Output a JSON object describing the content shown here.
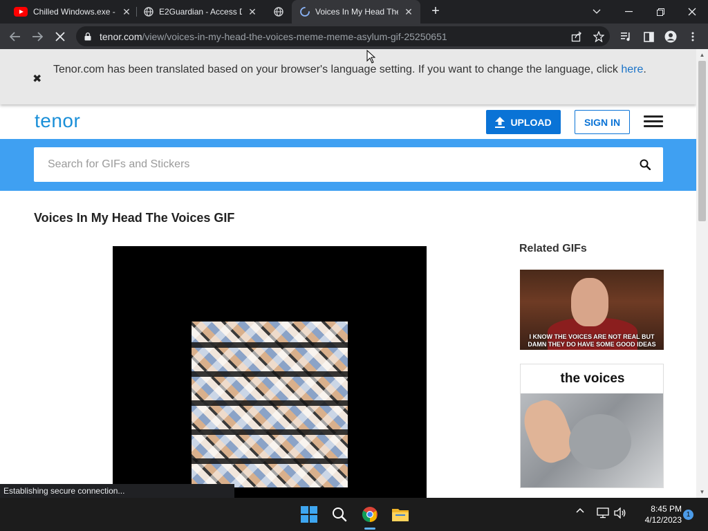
{
  "browser": {
    "tabs": [
      {
        "title": "Chilled Windows.exe -",
        "icon": "youtube-icon",
        "active": false
      },
      {
        "title": "E2Guardian - Access De",
        "icon": "globe-icon",
        "active": false
      },
      {
        "title": "",
        "icon": "globe-icon",
        "active": false
      },
      {
        "title": "Voices In My Head The",
        "icon": "loading-spinner-icon",
        "active": true
      }
    ],
    "url_host": "tenor.com",
    "url_path": "/view/voices-in-my-head-the-voices-meme-meme-asylum-gif-25250651",
    "status_text": "Establishing secure connection..."
  },
  "translate_bar": {
    "message": "Tenor.com has been translated based on your browser's language setting. If you want to change the language, click ",
    "link_text": "here",
    "suffix": "."
  },
  "header": {
    "logo": "tenor",
    "upload_label": "UPLOAD",
    "signin_label": "SIGN IN"
  },
  "search": {
    "placeholder": "Search for GIFs and Stickers"
  },
  "main": {
    "gif_title": "Voices In My Head The Voices GIF"
  },
  "related": {
    "title": "Related GIFs",
    "items": [
      {
        "caption": "I KNOW THE VOICES ARE NOT REAL BUT DAMN THEY DO HAVE SOME GOOD IDEAS"
      },
      {
        "caption": "the voices"
      }
    ]
  },
  "taskbar": {
    "time": "8:45 PM",
    "date": "4/12/2023",
    "notifications": "1"
  },
  "colors": {
    "accent": "#0a73d6",
    "search_band": "#3fa0f2",
    "browser_dark": "#202124"
  }
}
